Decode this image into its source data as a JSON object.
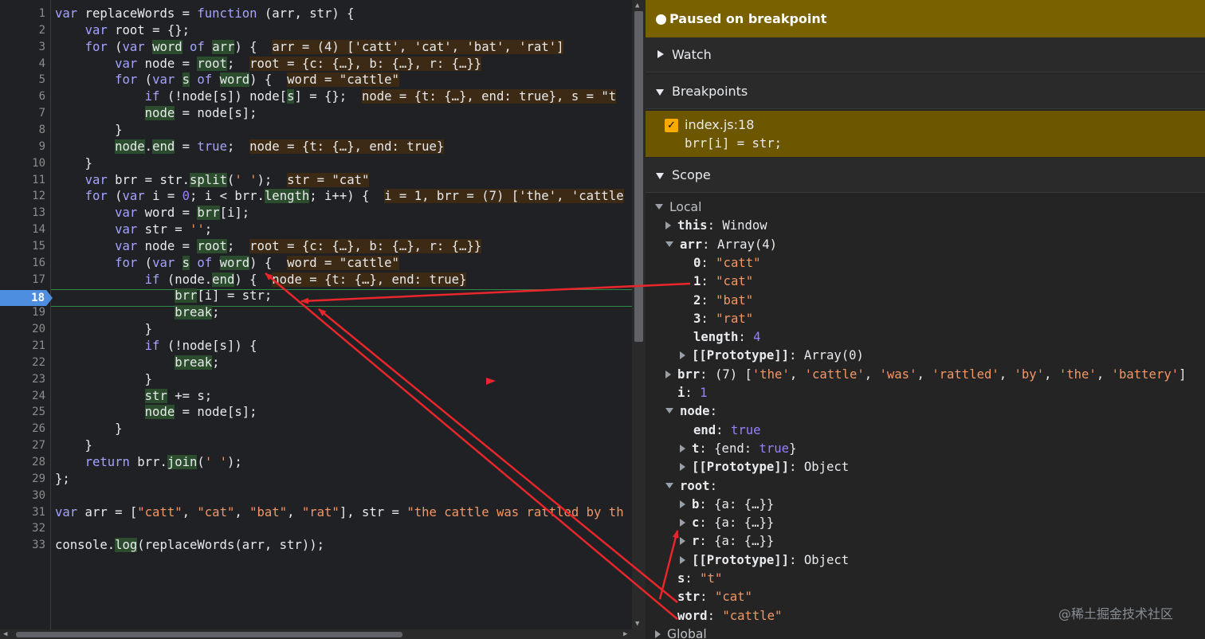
{
  "editor": {
    "lines": [
      {
        "n": "1",
        "html": "<span class=\"kw\">var</span> replaceWords = <span class=\"kw\">function</span> (arr, str) {"
      },
      {
        "n": "2",
        "html": "    <span class=\"kw\">var</span> root = {};"
      },
      {
        "n": "3",
        "html": "    <span class=\"kw\">for</span> (<span class=\"kw\">var</span> <span class=\"hl\">word</span> <span class=\"kw\">of</span> <span class=\"hl\">arr</span>) {  <span class=\"inl\">arr = (4) ['catt', 'cat', 'bat', 'rat']</span>"
      },
      {
        "n": "4",
        "html": "        <span class=\"kw\">var</span> node = <span class=\"hl\">root</span>;  <span class=\"inl\">root = {c: {…}, b: {…}, r: {…}}</span>"
      },
      {
        "n": "5",
        "html": "        <span class=\"kw\">for</span> (<span class=\"kw\">var</span> <span class=\"hl\">s</span> <span class=\"kw\">of</span> <span class=\"hl\">word</span>) {  <span class=\"inl\">word = \"cattle\"</span>"
      },
      {
        "n": "6",
        "html": "            <span class=\"kw\">if</span> (!node[s]) node[<span class=\"hl\">s</span>] = {};  <span class=\"inl\">node = {t: {…}, end: true}, s = \"t</span>"
      },
      {
        "n": "7",
        "html": "            <span class=\"hl\">node</span> = node[s];"
      },
      {
        "n": "8",
        "html": "        }"
      },
      {
        "n": "9",
        "html": "        <span class=\"hl\">node</span>.<span class=\"hl\">end</span> = <span class=\"kw\">true</span>;  <span class=\"inl\">node = {t: {…}, end: true}</span>"
      },
      {
        "n": "10",
        "html": "    }"
      },
      {
        "n": "11",
        "html": "    <span class=\"kw\">var</span> brr = str.<span class=\"hl\">split</span>(<span class=\"str\">' '</span>);  <span class=\"inl\">str = \"cat\"</span>"
      },
      {
        "n": "12",
        "html": "    <span class=\"kw\">for</span> (<span class=\"kw\">var</span> i = <span class=\"num\">0</span>; i &lt; brr.<span class=\"hl\">length</span>; i++) {  <span class=\"inl\">i = 1, brr = (7) ['the', 'cattle</span>"
      },
      {
        "n": "13",
        "html": "        <span class=\"kw\">var</span> word = <span class=\"hl\">brr</span>[i];"
      },
      {
        "n": "14",
        "html": "        <span class=\"kw\">var</span> str = <span class=\"str\">''</span>;"
      },
      {
        "n": "15",
        "html": "        <span class=\"kw\">var</span> node = <span class=\"hl\">root</span>;  <span class=\"inl\">root = {c: {…}, b: {…}, r: {…}}</span>"
      },
      {
        "n": "16",
        "html": "        <span class=\"kw\">for</span> (<span class=\"kw\">var</span> <span class=\"hl\">s</span> <span class=\"kw\">of</span> <span class=\"hl\">word</span>) {  <span class=\"inl\">word = \"cattle\"</span>"
      },
      {
        "n": "17",
        "html": "            <span class=\"kw\">if</span> (node.<span class=\"hl\">end</span>) {  <span class=\"inl\">node = {t: {…}, end: true}</span>"
      },
      {
        "n": "18",
        "html": "                <span class=\"hl\">brr</span>[i] = str;"
      },
      {
        "n": "19",
        "html": "                <span class=\"hl\">break</span>;"
      },
      {
        "n": "20",
        "html": "            }"
      },
      {
        "n": "21",
        "html": "            <span class=\"kw\">if</span> (!node[s]) {"
      },
      {
        "n": "22",
        "html": "                <span class=\"hl\">break</span>;"
      },
      {
        "n": "23",
        "html": "            }"
      },
      {
        "n": "24",
        "html": "            <span class=\"hl\">str</span> += s;"
      },
      {
        "n": "25",
        "html": "            <span class=\"hl\">node</span> = node[s];"
      },
      {
        "n": "26",
        "html": "        }"
      },
      {
        "n": "27",
        "html": "    }"
      },
      {
        "n": "28",
        "html": "    <span class=\"kw\">return</span> brr.<span class=\"hl\">join</span>(<span class=\"str\">' '</span>);"
      },
      {
        "n": "29",
        "html": "};"
      },
      {
        "n": "30",
        "html": ""
      },
      {
        "n": "31",
        "html": "<span class=\"kw\">var</span> arr = [<span class=\"str\">\"catt\"</span>, <span class=\"str\">\"cat\"</span>, <span class=\"str\">\"bat\"</span>, <span class=\"str\">\"rat\"</span>], str = <span class=\"str\">\"the cattle was rattled by th</span>"
      },
      {
        "n": "32",
        "html": ""
      },
      {
        "n": "33",
        "html": "console.<span class=\"hl\">log</span>(replaceWords(arr, str));"
      }
    ],
    "breakpoint_line": "18"
  },
  "debugger": {
    "paused_label": "Paused on breakpoint",
    "watch_label": "Watch",
    "breakpoints_label": "Breakpoints",
    "breakpoint_file": "index.js:18",
    "breakpoint_source": "brr[i] = str;",
    "scope_label": "Scope",
    "local_label": "Local",
    "global_label": "Global",
    "scope_rows": [
      {
        "indent": 0,
        "tri": "d",
        "html": "<span class=\"local\">Local</span>"
      },
      {
        "indent": 1,
        "tri": "r",
        "html": "<span class=\"k\">this</span>: Window"
      },
      {
        "indent": 1,
        "tri": "d",
        "html": "<span class=\"k\">arr</span>: Array(4)"
      },
      {
        "indent": 2,
        "tri": "",
        "html": "<span class=\"k\">0</span>: <span class=\"s\">\"catt\"</span>"
      },
      {
        "indent": 2,
        "tri": "",
        "html": "<span class=\"k\">1</span>: <span class=\"s\">\"cat\"</span>"
      },
      {
        "indent": 2,
        "tri": "",
        "html": "<span class=\"k\">2</span>: <span class=\"s\">\"bat\"</span>"
      },
      {
        "indent": 2,
        "tri": "",
        "html": "<span class=\"k\">3</span>: <span class=\"s\">\"rat\"</span>"
      },
      {
        "indent": 2,
        "tri": "",
        "html": "<span class=\"k\">length</span>: <span class=\"n\">4</span>"
      },
      {
        "indent": 2,
        "tri": "r",
        "html": "<span class=\"k\">[[Prototype]]</span>: Array(0)"
      },
      {
        "indent": 1,
        "tri": "r",
        "html": "<span class=\"k\">brr</span>: (7) [<span class=\"s\">'the'</span>, <span class=\"s\">'cattle'</span>, <span class=\"s\">'was'</span>, <span class=\"s\">'rattled'</span>, <span class=\"s\">'by'</span>, <span class=\"s\">'the'</span>, <span class=\"s\">'battery'</span>]"
      },
      {
        "indent": 1,
        "tri": "",
        "html": "<span class=\"k\">i</span>: <span class=\"n\">1</span>"
      },
      {
        "indent": 1,
        "tri": "d",
        "html": "<span class=\"k\">node</span>:"
      },
      {
        "indent": 2,
        "tri": "",
        "html": "<span class=\"k\">end</span>: <span class=\"b\">true</span>"
      },
      {
        "indent": 2,
        "tri": "r",
        "html": "<span class=\"k\">t</span>: {end: <span class=\"b\">true</span>}"
      },
      {
        "indent": 2,
        "tri": "r",
        "html": "<span class=\"k\">[[Prototype]]</span>: Object"
      },
      {
        "indent": 1,
        "tri": "d",
        "html": "<span class=\"k\">root</span>:"
      },
      {
        "indent": 2,
        "tri": "r",
        "html": "<span class=\"k\">b</span>: {a: {…}}"
      },
      {
        "indent": 2,
        "tri": "r",
        "html": "<span class=\"k\">c</span>: {a: {…}}"
      },
      {
        "indent": 2,
        "tri": "r",
        "html": "<span class=\"k\">r</span>: {a: {…}}"
      },
      {
        "indent": 2,
        "tri": "r",
        "html": "<span class=\"k\">[[Prototype]]</span>: Object"
      },
      {
        "indent": 1,
        "tri": "",
        "html": "<span class=\"k\">s</span>: <span class=\"s\">\"t\"</span>"
      },
      {
        "indent": 1,
        "tri": "",
        "html": "<span class=\"k\">str</span>: <span class=\"s\">\"cat\"</span>"
      },
      {
        "indent": 1,
        "tri": "",
        "html": "<span class=\"k\">word</span>: <span class=\"s\">\"cattle\"</span>"
      },
      {
        "indent": 0,
        "tri": "r",
        "html": "<span class=\"local\">Global</span>"
      }
    ]
  },
  "watermark": "@稀土掘金技术社区",
  "colors": {
    "accent_paused": "#7a6100",
    "breakpoint_blue": "#4d8ee0",
    "annotation_red": "#e8262b"
  }
}
